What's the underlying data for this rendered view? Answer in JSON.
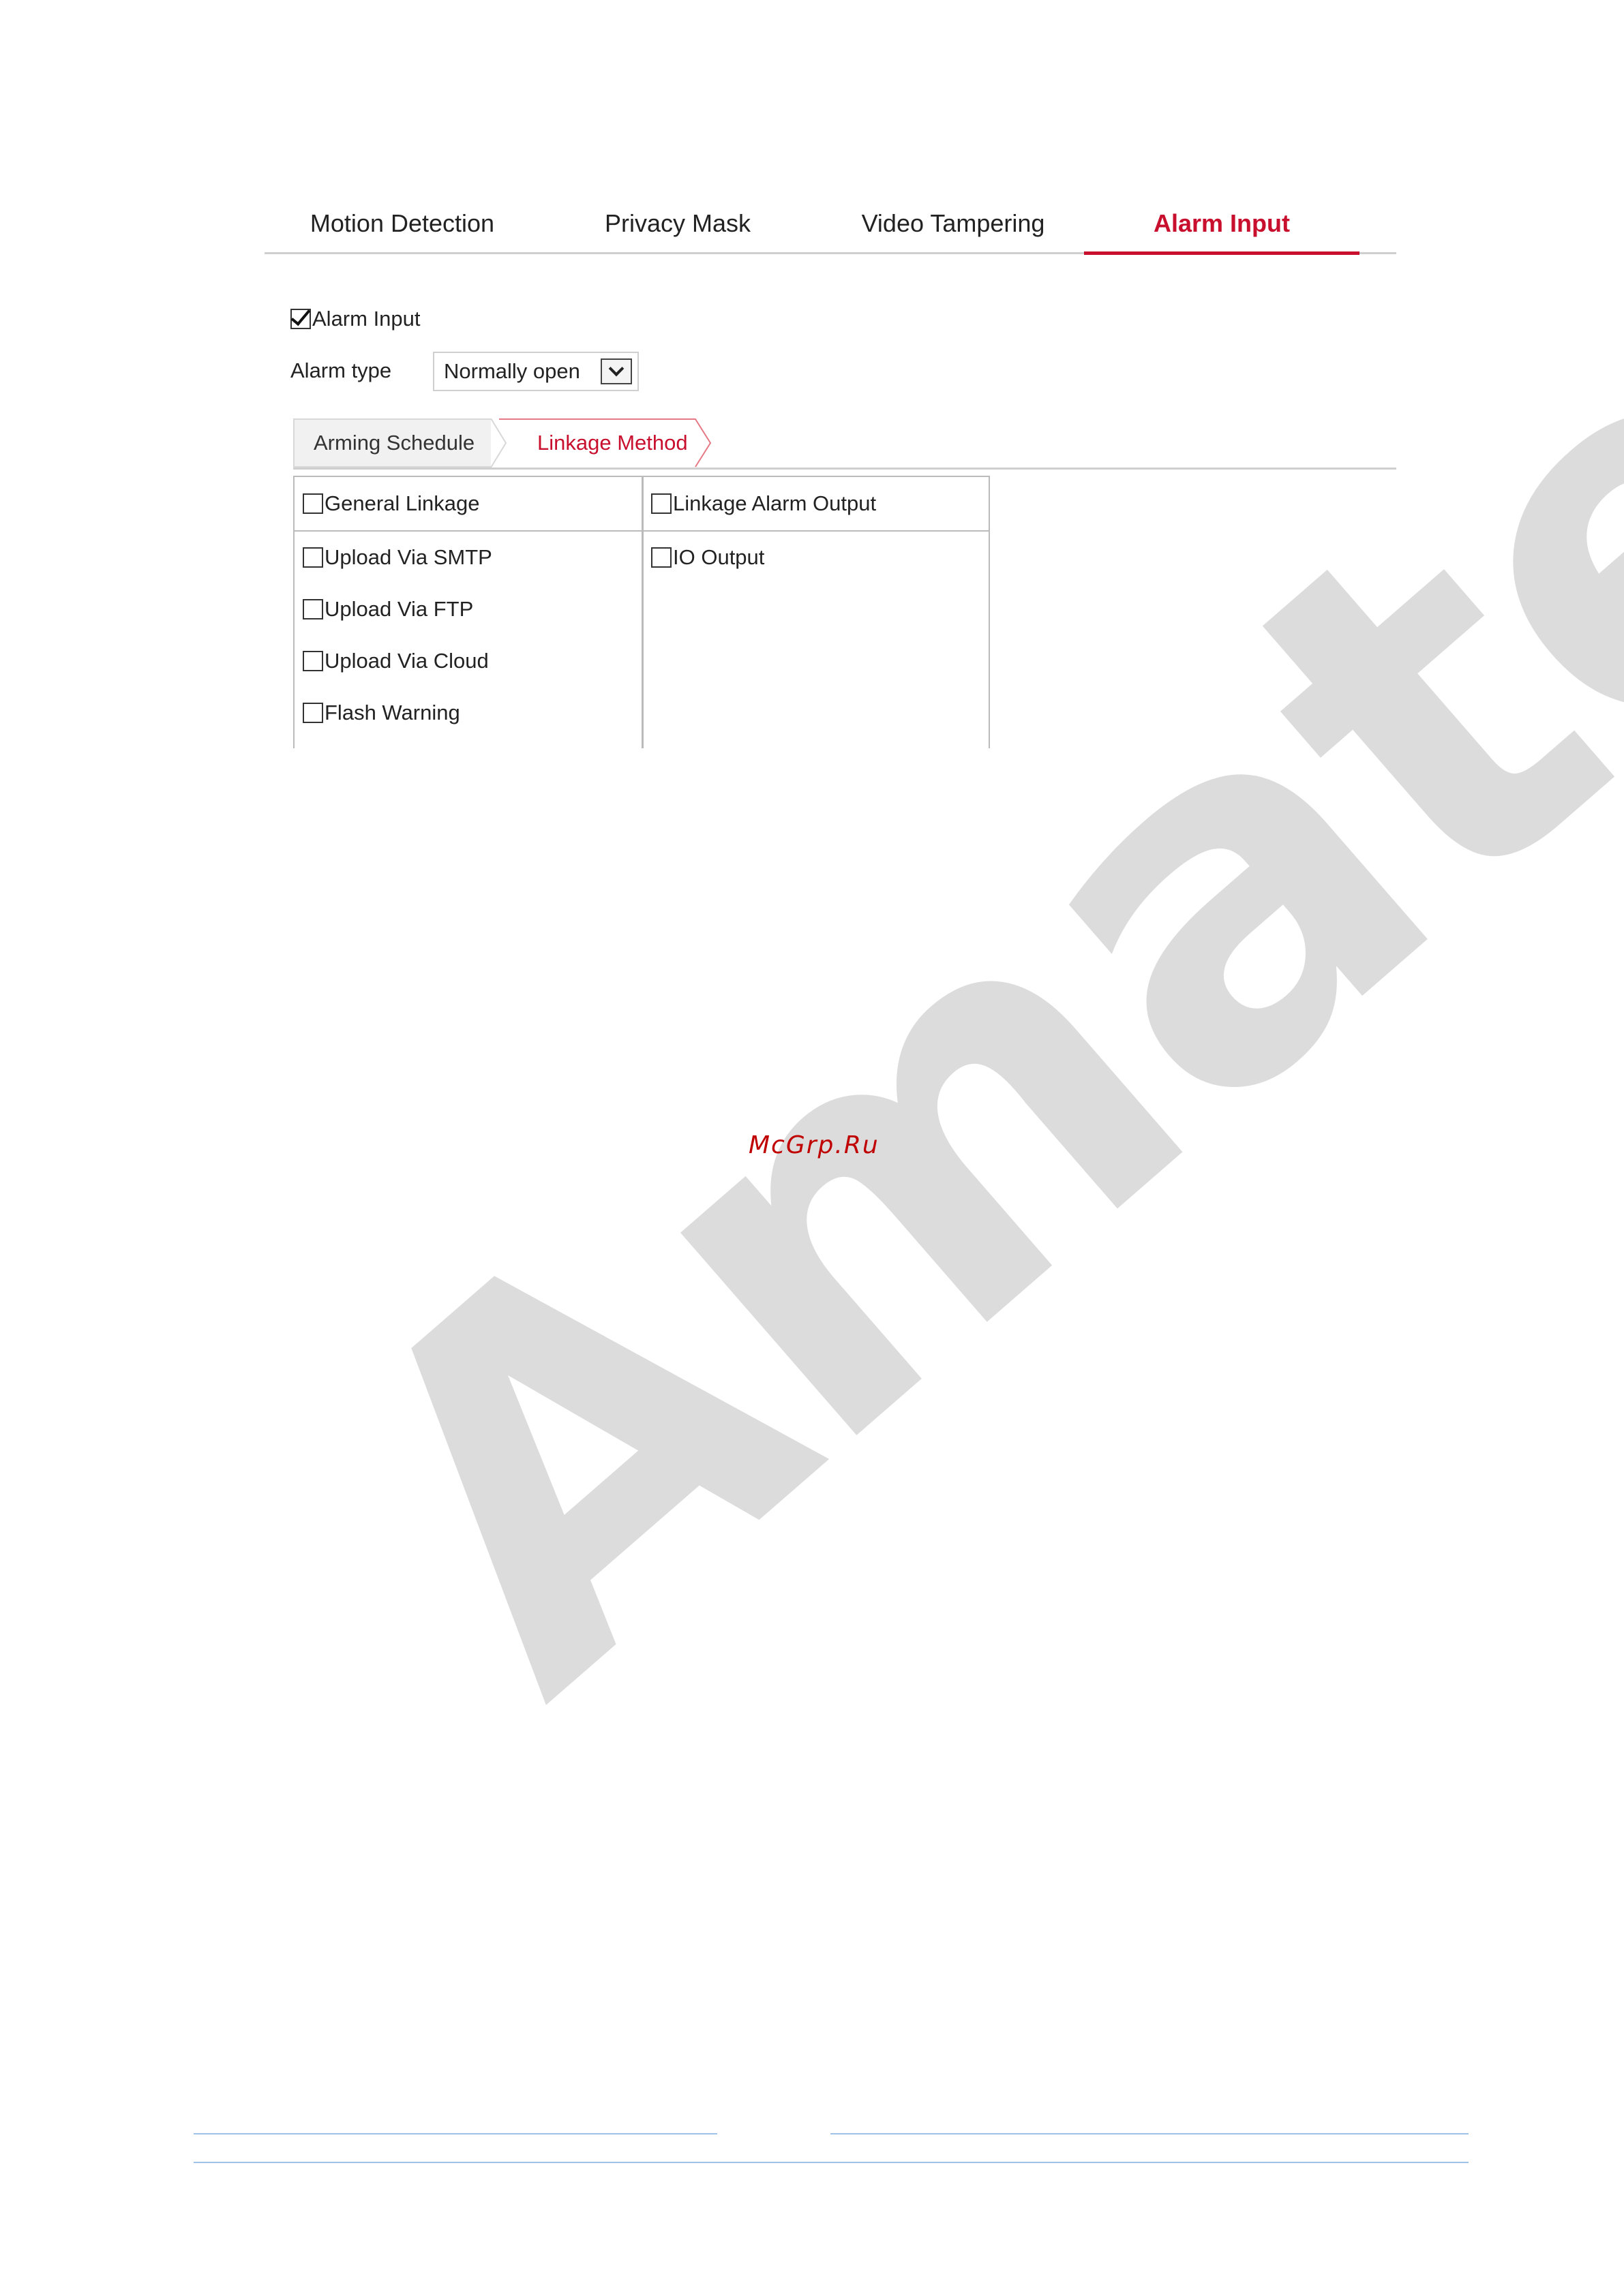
{
  "tabs": [
    {
      "label": "Motion Detection",
      "active": false
    },
    {
      "label": "Privacy Mask",
      "active": false
    },
    {
      "label": "Video Tampering",
      "active": false
    },
    {
      "label": "Alarm Input",
      "active": true
    }
  ],
  "alarm_input": {
    "label": "Alarm Input",
    "checked": true
  },
  "alarm_type": {
    "label": "Alarm type",
    "value": "Normally open"
  },
  "subtabs": [
    {
      "label": "Arming Schedule",
      "active": false
    },
    {
      "label": "Linkage Method",
      "active": true
    }
  ],
  "linkage": {
    "left_header": "General Linkage",
    "left_items": [
      "Upload Via SMTP",
      "Upload Via FTP",
      "Upload Via Cloud",
      "Flash Warning"
    ],
    "right_header": "Linkage Alarm Output",
    "right_items": [
      "IO Output"
    ]
  },
  "watermark": "Amatek",
  "site_mark": "McGrp.Ru",
  "colors": {
    "accent": "#c8102e",
    "watermark": "#dcdcdc",
    "footer_line": "#9fc3e7"
  }
}
